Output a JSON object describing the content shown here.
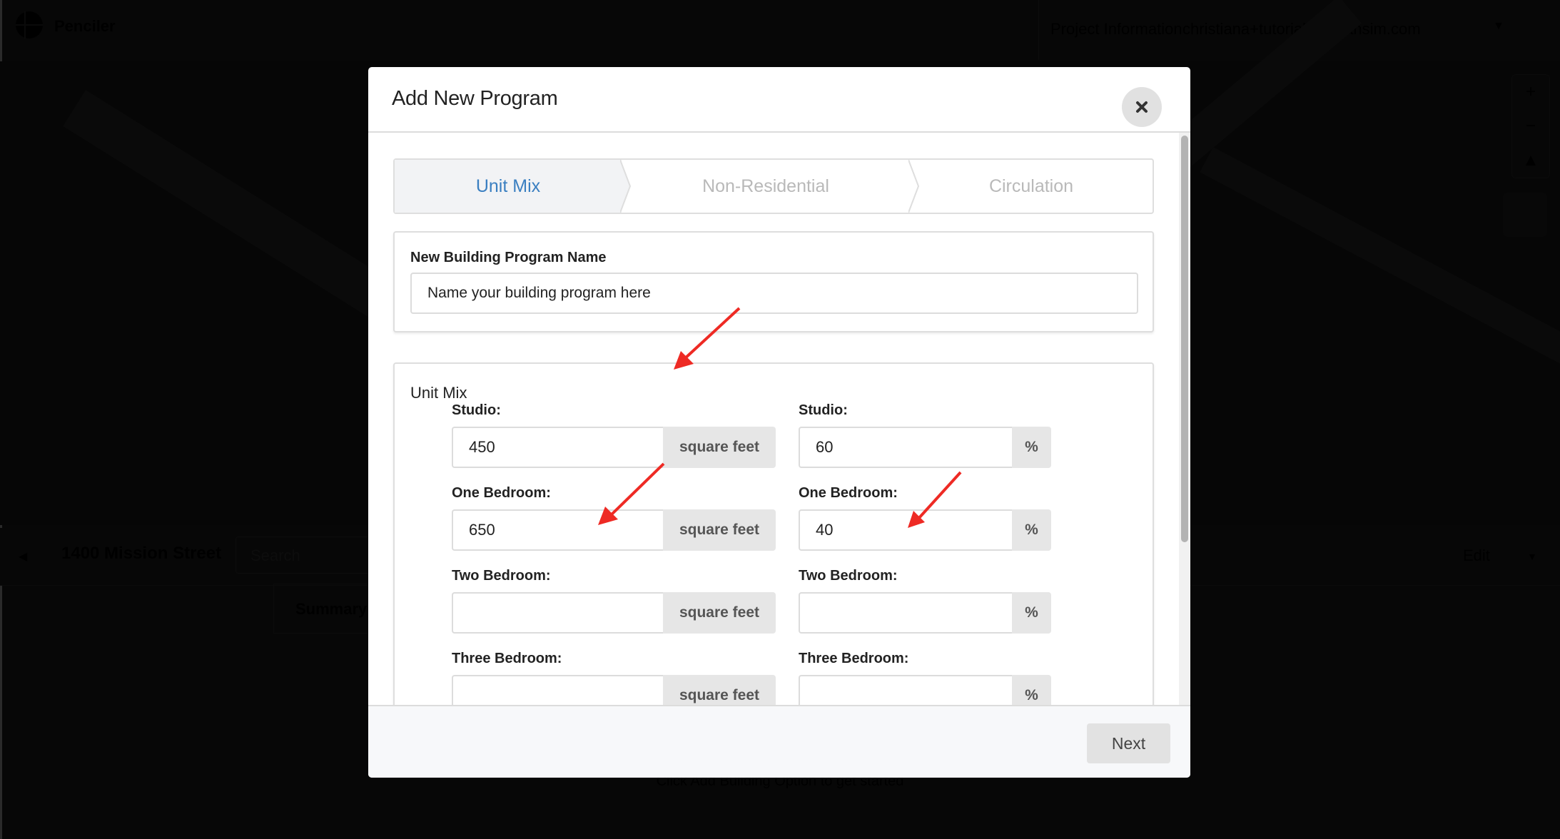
{
  "background_app": {
    "app_name": "Penciler",
    "project_menu": "Project Information",
    "user_menu": "christiana+tutorial@urbansim.com",
    "address": "1400 Mission Street",
    "search_placeholder": "Search",
    "edit_label": "Edit",
    "summary_label": "Summary",
    "hint_text": "Click Add Building Option to get started",
    "map_controls": {
      "zoom_in": "+",
      "zoom_out": "−",
      "compass": "▲"
    }
  },
  "modal": {
    "title": "Add New Program",
    "close_icon": "close-icon",
    "tabs": [
      {
        "label": "Unit Mix",
        "active": true
      },
      {
        "label": "Non-Residential",
        "active": false
      },
      {
        "label": "Circulation",
        "active": false
      }
    ],
    "name_section": {
      "label": "New Building Program Name",
      "placeholder": "Name your building program here",
      "value": ""
    },
    "unit_mix": {
      "title": "Unit Mix",
      "size_unit": "square feet",
      "percent_unit": "%",
      "rows": [
        {
          "label": "Studio:",
          "size": "450",
          "percent": "60"
        },
        {
          "label": "One Bedroom:",
          "size": "650",
          "percent": "40"
        },
        {
          "label": "Two Bedroom:",
          "size": "",
          "percent": ""
        },
        {
          "label": "Three Bedroom:",
          "size": "",
          "percent": ""
        }
      ]
    },
    "footer": {
      "next_label": "Next"
    }
  },
  "annotations": {
    "arrow_color": "#ee2a24",
    "count": 3
  },
  "colors": {
    "active_tab_text": "#3a7fc1",
    "inactive_tab_text": "#b9b9b9",
    "overlay": "#070707"
  }
}
